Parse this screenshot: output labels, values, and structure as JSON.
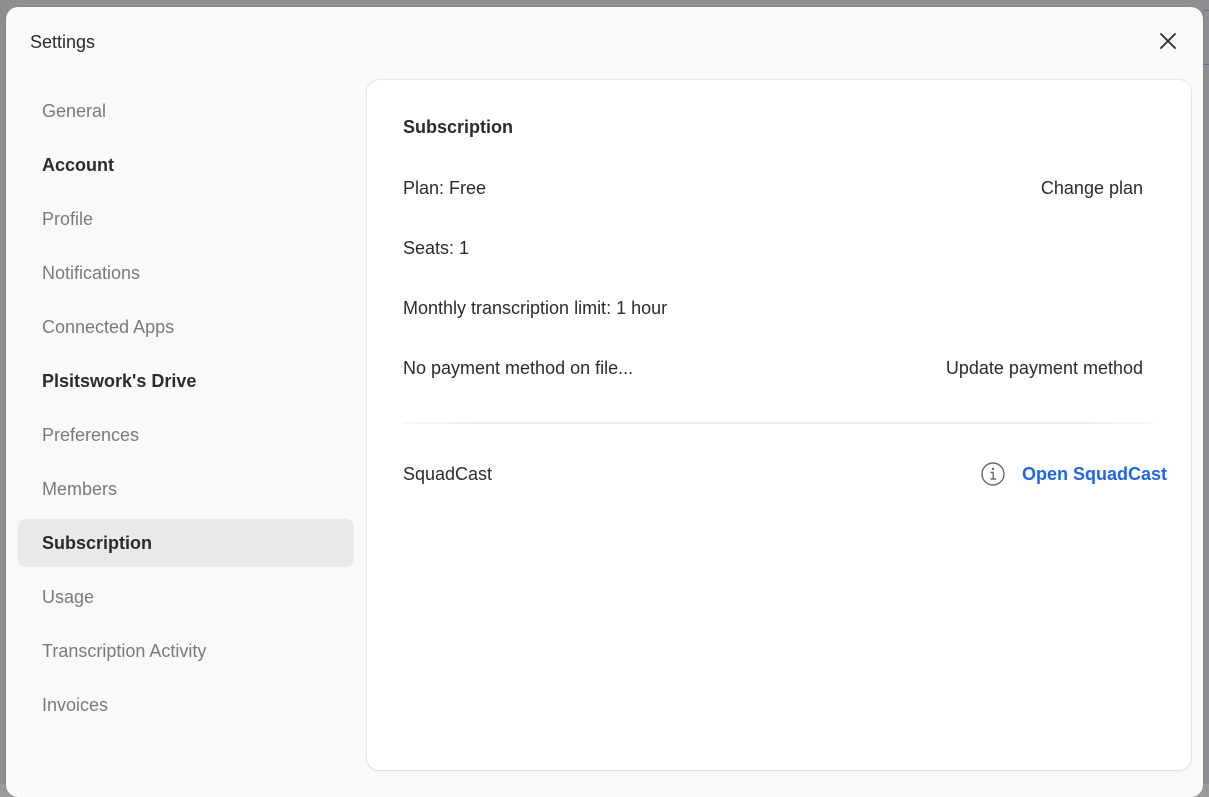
{
  "dialog": {
    "title": "Settings"
  },
  "sidebar": {
    "general": "General",
    "sections": {
      "account": "Account",
      "drive": "Plsitswork's Drive"
    },
    "account_items": [
      {
        "label": "Profile"
      },
      {
        "label": "Notifications"
      },
      {
        "label": "Connected Apps"
      }
    ],
    "drive_items": [
      {
        "label": "Preferences"
      },
      {
        "label": "Members"
      },
      {
        "label": "Subscription",
        "active": true
      },
      {
        "label": "Usage"
      },
      {
        "label": "Transcription Activity"
      },
      {
        "label": "Invoices"
      }
    ]
  },
  "subscription": {
    "title": "Subscription",
    "plan": "Plan: Free",
    "change_plan": "Change plan",
    "seats": "Seats: 1",
    "limit": "Monthly transcription limit: 1 hour",
    "payment": "No payment method on file...",
    "update_payment": "Update payment method",
    "squadcast_label": "SquadCast",
    "open_squadcast": "Open SquadCast"
  },
  "colors": {
    "link": "#1f66e5",
    "active_bg": "#ebe9e7",
    "panel_bg": "#ffffff",
    "dialog_bg": "#faf9f7"
  },
  "icons": [
    "close-icon",
    "info-icon"
  ]
}
